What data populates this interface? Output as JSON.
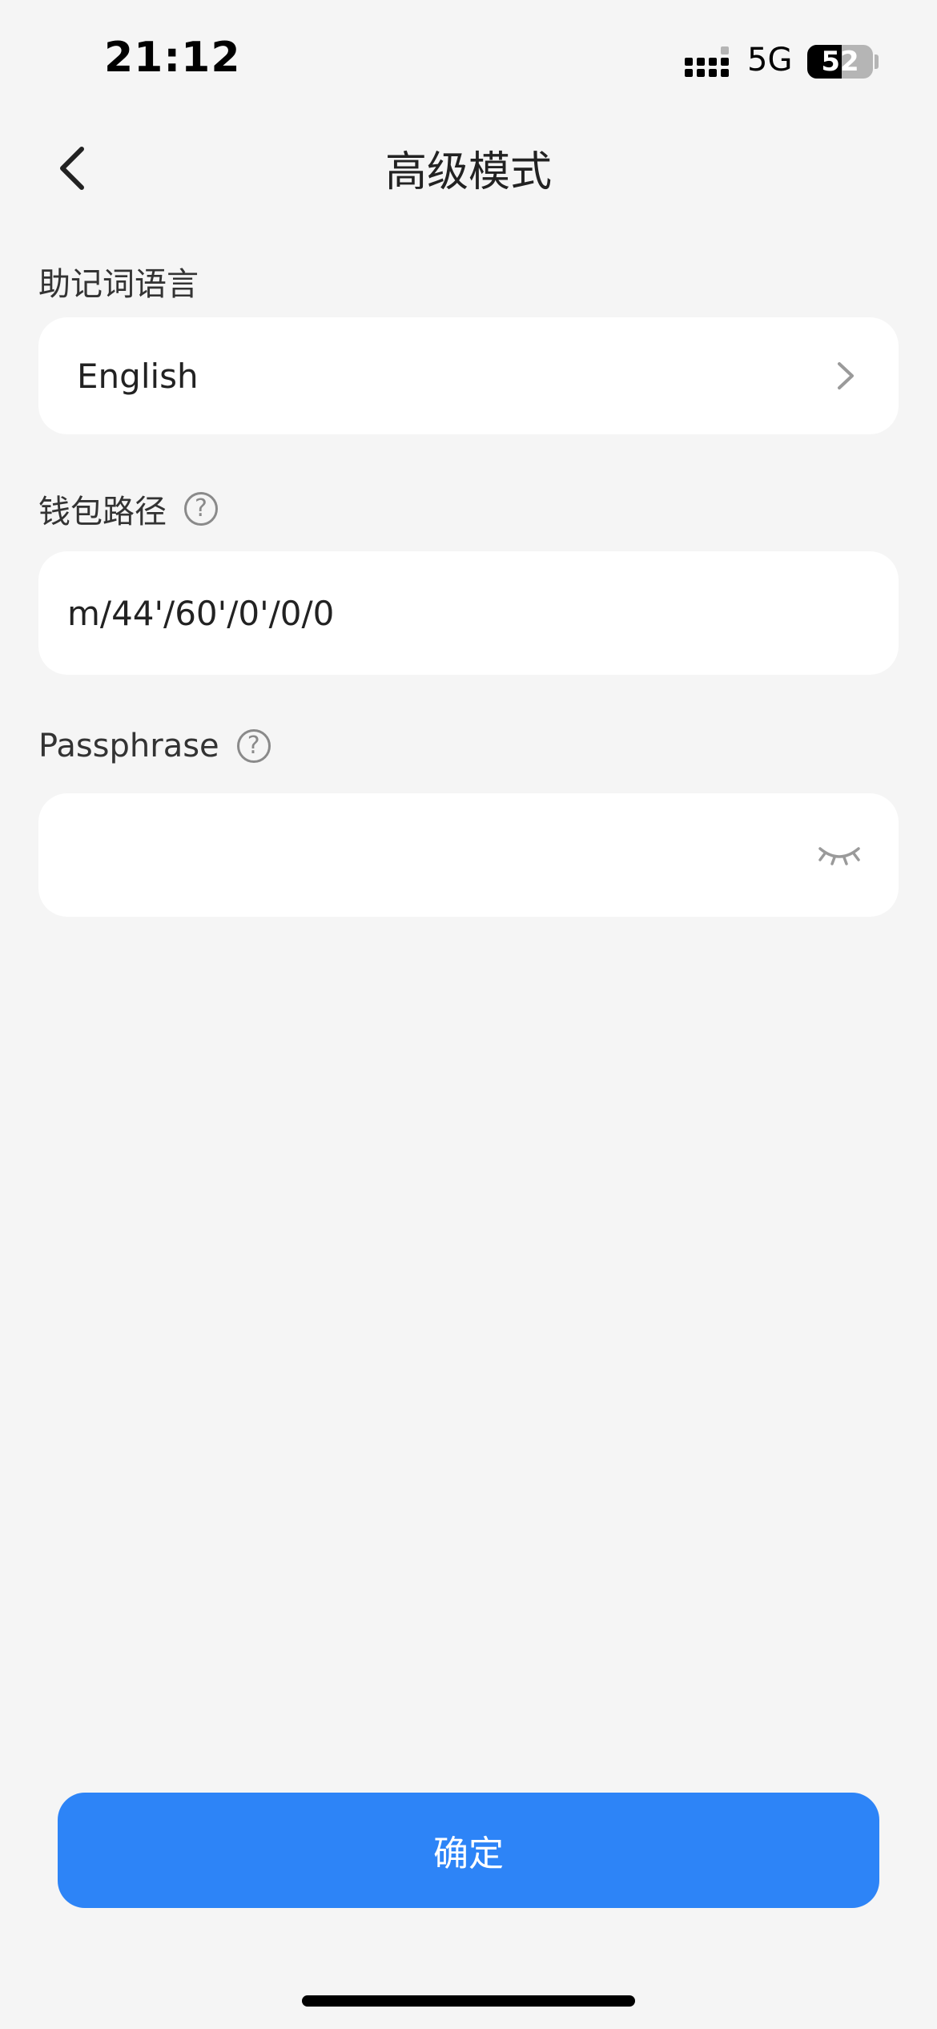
{
  "status_bar": {
    "time": "21:12",
    "network": "5G",
    "battery": "52",
    "battery_level": 0.52
  },
  "nav": {
    "back_icon": "chevron-left-icon",
    "title": "高级模式"
  },
  "mnemonic_language": {
    "label": "助记词语言",
    "value": "English",
    "chevron_icon": "chevron-right-icon"
  },
  "wallet_path": {
    "label": "钱包路径",
    "help_icon": "question-circle-icon",
    "help_glyph": "?",
    "value": "m/44'/60'/0'/0/0"
  },
  "passphrase": {
    "label": "Passphrase",
    "help_icon": "question-circle-icon",
    "help_glyph": "?",
    "value": "",
    "visibility_icon": "eye-closed-icon"
  },
  "confirm_button": {
    "label": "确定",
    "color": "#2d84f7"
  }
}
